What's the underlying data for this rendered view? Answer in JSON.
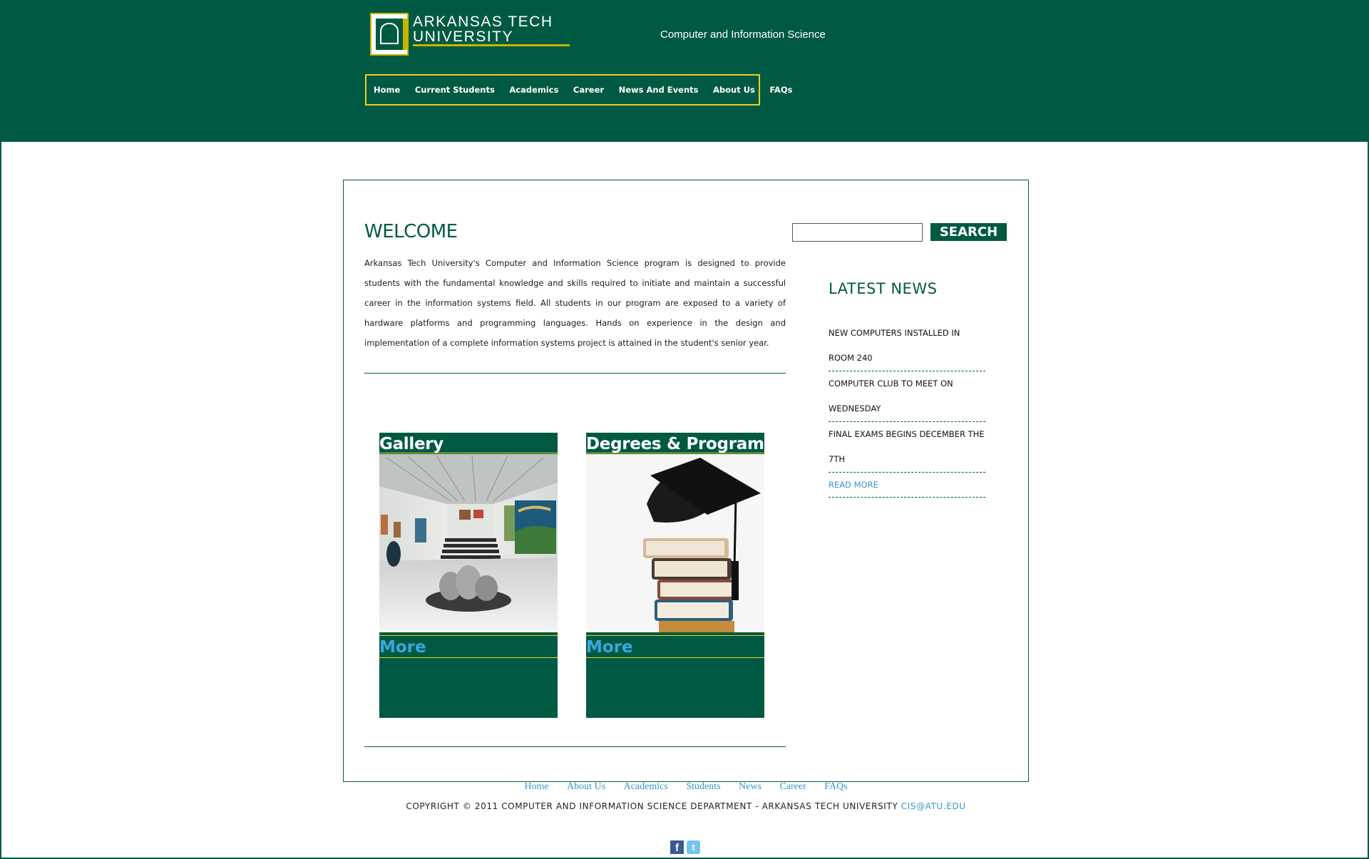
{
  "header": {
    "logo_line1": "ARKANSAS TECH",
    "logo_line2": "UNIVERSITY",
    "department": "Computer and Information Science"
  },
  "nav": {
    "items": [
      "Home",
      "Current Students",
      "Academics",
      "Career",
      "News And Events",
      "About Us",
      "FAQs"
    ]
  },
  "main": {
    "welcome_title": "WELCOME",
    "intro": "Arkansas Tech University's Computer and Information Science program is designed to provide students with the fundamental knowledge and skills required to initiate and maintain a successful career in the information systems field. All students in our program are exposed to a variety of hardware platforms and programming languages. Hands on experience in the design and implementation of a complete information systems project is attained in the student's senior year."
  },
  "search": {
    "value": "",
    "button_label": "SEARCH"
  },
  "news": {
    "title": "LATEST NEWS",
    "items": [
      "NEW COMPUTERS INSTALLED IN ROOM 240",
      "COMPUTER CLUB TO MEET ON WEDNESDAY",
      "FINAL EXAMS BEGINS DECEMBER THE 7TH"
    ],
    "read_more": "READ MORE"
  },
  "cards": [
    {
      "title": "Gallery",
      "more": "More"
    },
    {
      "title": "Degrees & Programs",
      "more": "More"
    }
  ],
  "footer": {
    "nav": [
      "Home",
      "About Us",
      "Academics",
      "Students",
      "News",
      "Career",
      "FAQs"
    ],
    "copyright": "COPYRIGHT © 2011 COMPUTER AND INFORMATION SCIENCE DEPARTMENT - ARKANSAS TECH UNIVERSITY",
    "email": "CIS@ATU.EDU"
  },
  "colors": {
    "brand_green": "#005a43",
    "accent_gold": "#e8d21a",
    "link_blue": "#3a96c9"
  },
  "icons": [
    "facebook-icon",
    "twitter-icon"
  ]
}
